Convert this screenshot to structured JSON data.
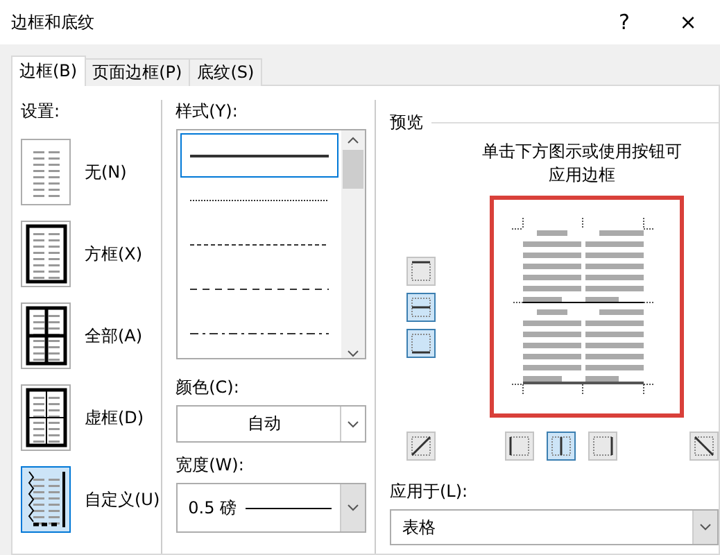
{
  "window": {
    "title": "边框和底纹",
    "help": "?",
    "close": "×"
  },
  "tabs": [
    {
      "label": "边框(B)",
      "selected": true
    },
    {
      "label": "页面边框(P)",
      "selected": false
    },
    {
      "label": "底纹(S)",
      "selected": false
    }
  ],
  "settings": {
    "label": "设置:",
    "items": [
      {
        "label": "无(N)",
        "kind": "none",
        "selected": false
      },
      {
        "label": "方框(X)",
        "kind": "box",
        "selected": false
      },
      {
        "label": "全部(A)",
        "kind": "all",
        "selected": false
      },
      {
        "label": "虚框(D)",
        "kind": "grid",
        "selected": false
      },
      {
        "label": "自定义(U)",
        "kind": "custom",
        "selected": true
      }
    ]
  },
  "style": {
    "label": "样式(Y):",
    "items": [
      {
        "kind": "solid",
        "selected": true
      },
      {
        "kind": "dotted",
        "selected": false
      },
      {
        "kind": "dashed",
        "selected": false
      },
      {
        "kind": "wide-dashed",
        "selected": false
      },
      {
        "kind": "dash-dot",
        "selected": false
      }
    ]
  },
  "color": {
    "label": "颜色(C):",
    "value": "自动"
  },
  "width": {
    "label": "宽度(W):",
    "value": "0.5 磅"
  },
  "preview": {
    "label": "预览",
    "hint": "单击下方图示或使用按钮可应用边框",
    "side_buttons": [
      {
        "kind": "top",
        "selected": false
      },
      {
        "kind": "middle",
        "selected": true
      },
      {
        "kind": "bottom",
        "selected": true
      }
    ],
    "bottom_buttons": [
      {
        "kind": "diag-up",
        "selected": false
      },
      {
        "kind": "left",
        "selected": false
      },
      {
        "kind": "center",
        "selected": true
      },
      {
        "kind": "right",
        "selected": false
      },
      {
        "kind": "diag-down",
        "selected": false
      }
    ]
  },
  "apply_to": {
    "label": "应用于(L):",
    "value": "表格"
  }
}
